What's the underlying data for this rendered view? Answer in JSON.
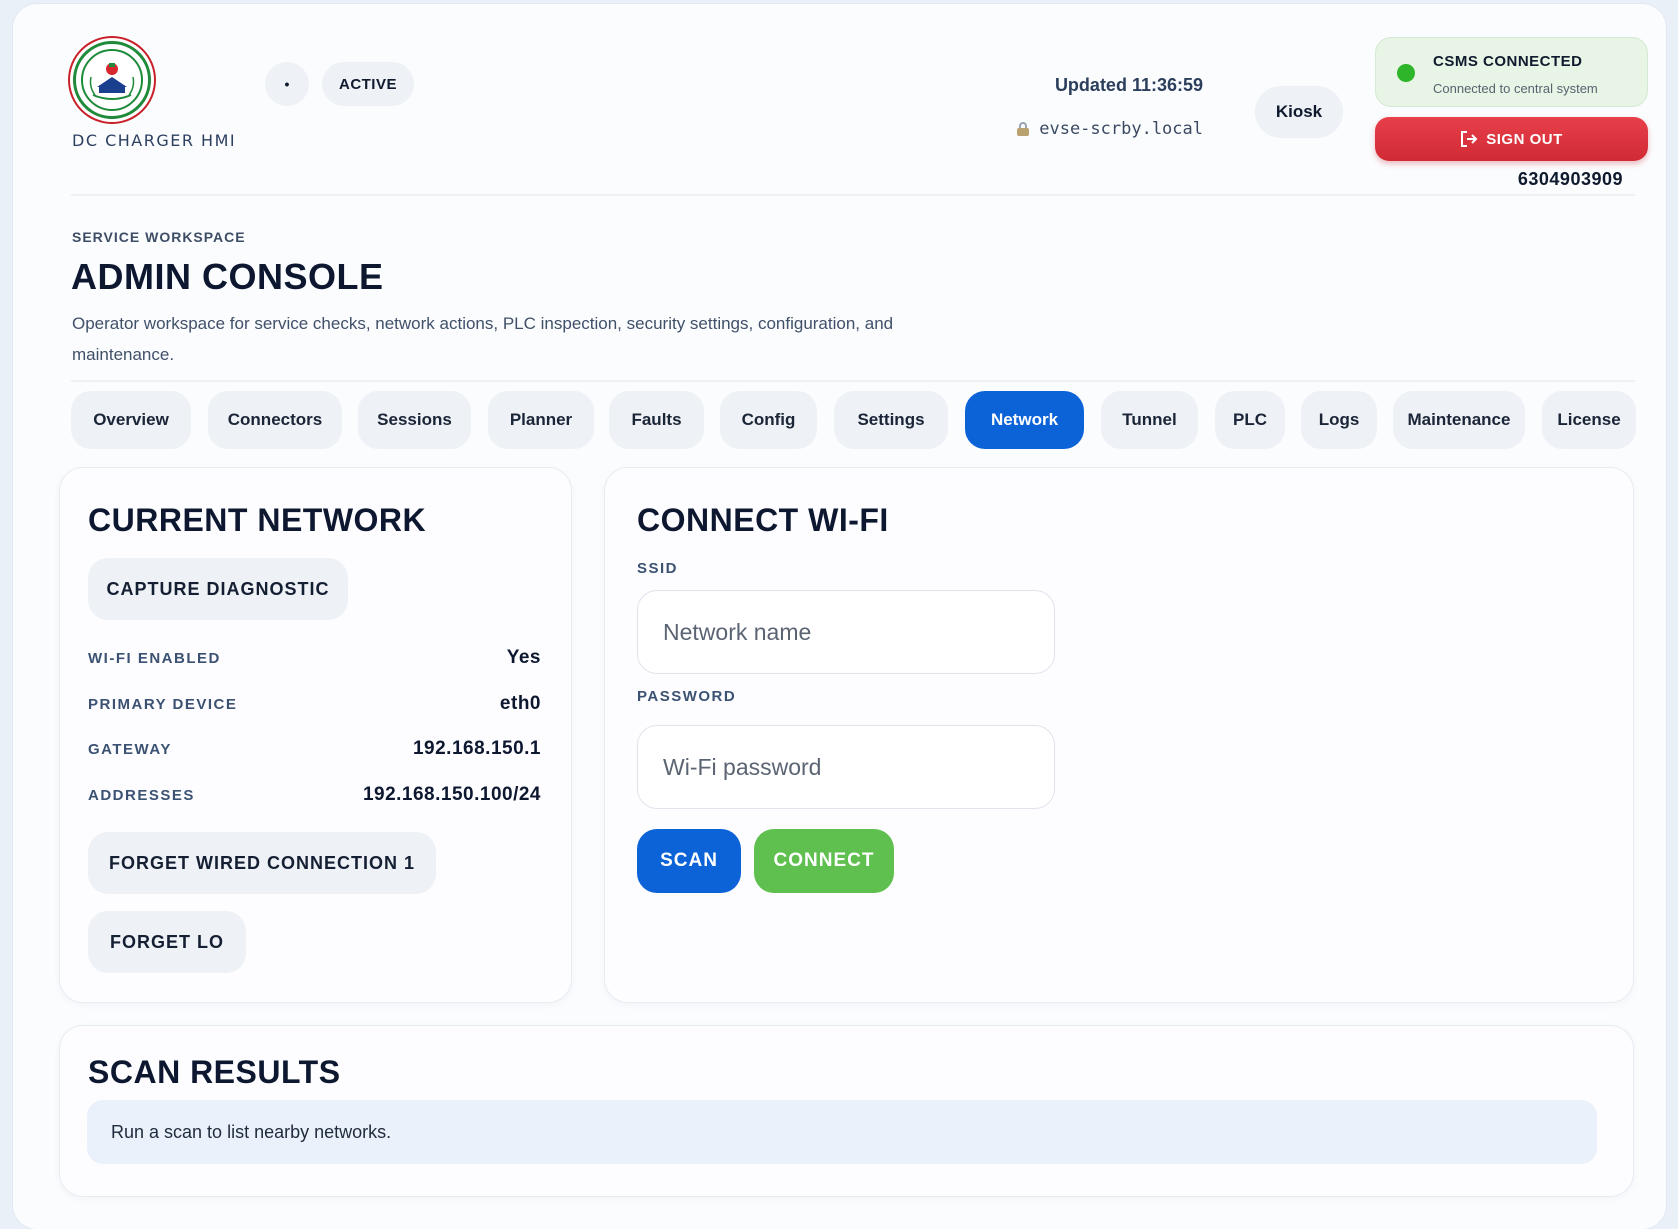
{
  "header": {
    "brand": "DC CHARGER HMI",
    "status_dot": "•",
    "status": "ACTIVE",
    "updated": "Updated 11:36:59",
    "host": "evse-scrby.local",
    "kiosk": "Kiosk",
    "csms_title": "CSMS CONNECTED",
    "csms_subtitle": "Connected to central system",
    "sign_out": "SIGN OUT",
    "phone": "6304903909"
  },
  "page": {
    "eyebrow": "SERVICE WORKSPACE",
    "title": "ADMIN CONSOLE",
    "description": "Operator workspace for service checks, network actions, PLC inspection, security settings, configuration, and maintenance."
  },
  "tabs": [
    {
      "label": "Overview"
    },
    {
      "label": "Connectors"
    },
    {
      "label": "Sessions"
    },
    {
      "label": "Planner"
    },
    {
      "label": "Faults"
    },
    {
      "label": "Config"
    },
    {
      "label": "Settings"
    },
    {
      "label": "Network",
      "active": true
    },
    {
      "label": "Tunnel"
    },
    {
      "label": "PLC"
    },
    {
      "label": "Logs"
    },
    {
      "label": "Maintenance"
    },
    {
      "label": "License"
    }
  ],
  "current_network": {
    "title": "CURRENT NETWORK",
    "capture_button": "CAPTURE DIAGNOSTIC",
    "rows": [
      {
        "label": "WI-FI ENABLED",
        "value": "Yes"
      },
      {
        "label": "PRIMARY DEVICE",
        "value": "eth0"
      },
      {
        "label": "GATEWAY",
        "value": "192.168.150.1"
      },
      {
        "label": "ADDRESSES",
        "value": "192.168.150.100/24"
      }
    ],
    "forget_wired": "FORGET WIRED CONNECTION 1",
    "forget_lo": "FORGET LO"
  },
  "connect_wifi": {
    "title": "CONNECT WI-FI",
    "ssid_label": "SSID",
    "ssid_placeholder": "Network name",
    "ssid_value": "",
    "password_label": "PASSWORD",
    "password_placeholder": "Wi-Fi password",
    "password_value": "",
    "scan_button": "SCAN",
    "connect_button": "CONNECT"
  },
  "scan_results": {
    "title": "SCAN RESULTS",
    "empty_message": "Run a scan to list nearby networks."
  },
  "colors": {
    "accent": "#0c63d8",
    "success": "#5fbf4f",
    "danger": "#d02a34",
    "status_ok": "#2fb52a"
  },
  "icons": {
    "logo": "charger-logo-icon",
    "lock": "lock-icon",
    "sign_out": "sign-out-icon",
    "connected": "status-dot-icon"
  }
}
